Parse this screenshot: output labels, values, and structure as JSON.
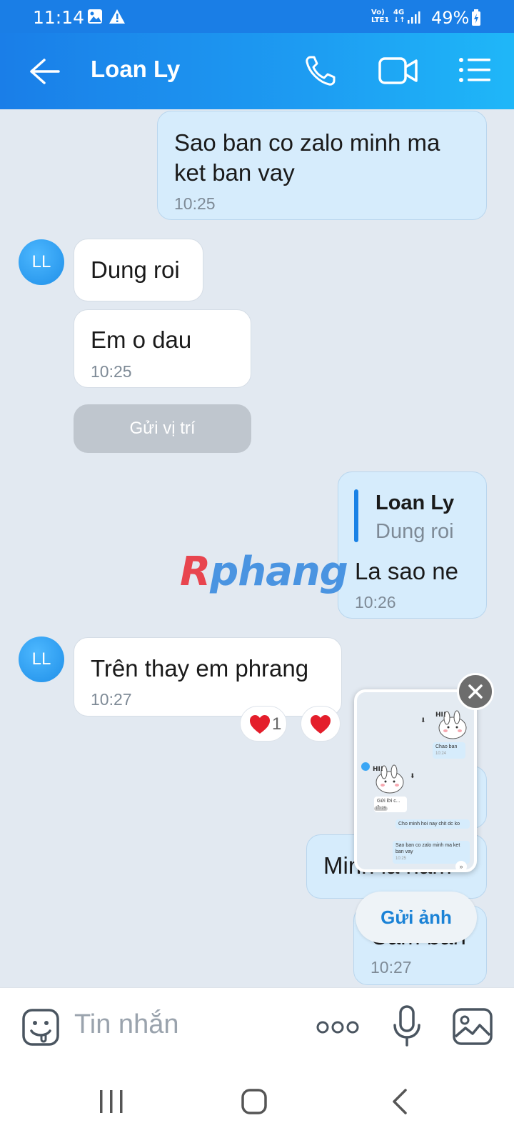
{
  "status_bar": {
    "time": "11:14",
    "network_top": "Vo)",
    "network_bottom": "LTE1",
    "network_type": "4G",
    "battery": "49%",
    "icons": [
      "image-icon",
      "warning-icon",
      "signal-icon",
      "battery-charging-icon"
    ]
  },
  "header": {
    "title": "Loan Ly",
    "icons": [
      "back-arrow-icon",
      "phone-icon",
      "video-call-icon",
      "menu-icon"
    ]
  },
  "messages": [
    {
      "sender": "me",
      "text_line1": "Sao ban co zalo minh ma",
      "text_line2": "ket ban vay",
      "time": "10:25"
    },
    {
      "sender": "Loan Ly",
      "avatar": "LL",
      "text": "Dung roi"
    },
    {
      "sender": "Loan Ly",
      "text": "Em o dau",
      "time": "10:25"
    },
    {
      "sender": "Loan Ly",
      "type": "location",
      "text": "Gửi vị trí"
    },
    {
      "sender": "me",
      "quote_name": "Loan Ly",
      "quote_text": "Dung roi",
      "text": "La sao ne",
      "time": "10:26"
    },
    {
      "sender": "Loan Ly",
      "avatar": "LL",
      "text": "Trên thay em phrang",
      "time": "10:27",
      "reaction_count": "1"
    },
    {
      "sender": "me",
      "text": "Minh la nam",
      "partially_hidden": true
    },
    {
      "sender": "me",
      "text": "Cam ban",
      "time": "10:27",
      "partially_hidden": true
    }
  ],
  "watermark": {
    "first": "R",
    "rest": "phang"
  },
  "thumbnail": {
    "b1": "Chao ban",
    "b1_time": "10:24",
    "b2": "Gửi lời c... 1",
    "b2_time": "10:25",
    "b3": "Cho minh hoi nay chit dc ko",
    "b4": "Sao ban co zalo minh ma ket ban vay",
    "b4_time": "10:25",
    "sticker_text": "HI!"
  },
  "send_photo_label": "Gửi ảnh",
  "input": {
    "placeholder": "Tin nhắn",
    "icons": [
      "sticker-icon",
      "more-icon",
      "microphone-icon",
      "gallery-icon"
    ]
  },
  "colors": {
    "header_start": "#1a7ee8",
    "header_end": "#1fb7f8",
    "my_bubble": "#d6ecfc",
    "background": "#e2e9f1"
  }
}
